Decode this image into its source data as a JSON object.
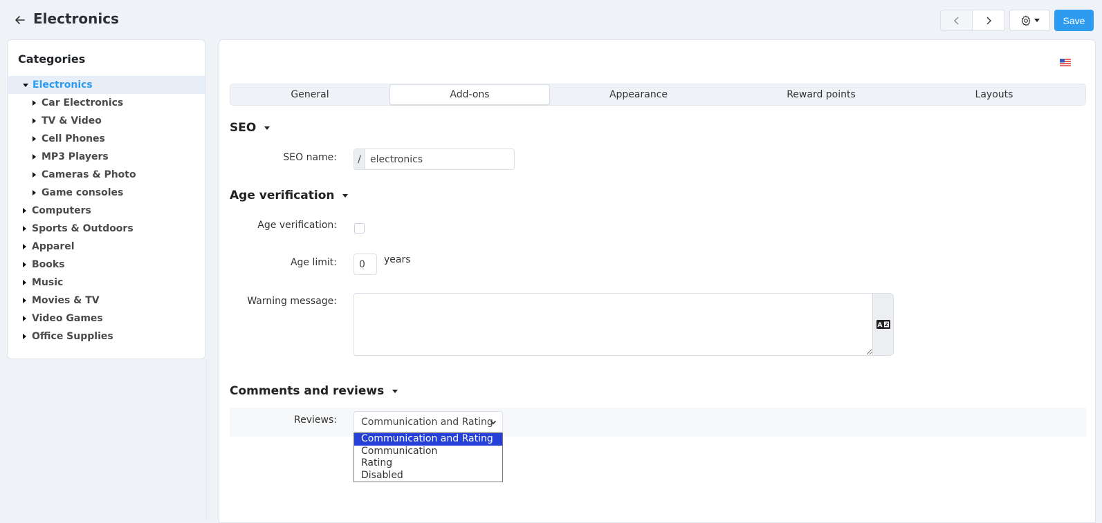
{
  "header": {
    "title": "Electronics",
    "save_label": "Save"
  },
  "sidebar": {
    "title": "Categories",
    "items": [
      {
        "label": "Electronics",
        "level": 0,
        "expanded": true,
        "active": true
      },
      {
        "label": "Car Electronics",
        "level": 1
      },
      {
        "label": "TV & Video",
        "level": 1
      },
      {
        "label": "Cell Phones",
        "level": 1
      },
      {
        "label": "MP3 Players",
        "level": 1
      },
      {
        "label": "Cameras & Photo",
        "level": 1
      },
      {
        "label": "Game consoles",
        "level": 1
      },
      {
        "label": "Computers",
        "level": 0
      },
      {
        "label": "Sports & Outdoors",
        "level": 0
      },
      {
        "label": "Apparel",
        "level": 0
      },
      {
        "label": "Books",
        "level": 0
      },
      {
        "label": "Music",
        "level": 0
      },
      {
        "label": "Movies & TV",
        "level": 0
      },
      {
        "label": "Video Games",
        "level": 0
      },
      {
        "label": "Office Supplies",
        "level": 0
      }
    ]
  },
  "tabs": [
    {
      "label": "General"
    },
    {
      "label": "Add-ons",
      "active": true
    },
    {
      "label": "Appearance"
    },
    {
      "label": "Reward points"
    },
    {
      "label": "Layouts"
    }
  ],
  "seo": {
    "title": "SEO",
    "name_label": "SEO name:",
    "prefix": "/",
    "name_value": "electronics"
  },
  "age": {
    "title": "Age verification",
    "verification_label": "Age verification:",
    "verification_checked": false,
    "limit_label": "Age limit:",
    "limit_value": "0",
    "limit_unit": "years",
    "warning_label": "Warning message:",
    "warning_value": ""
  },
  "comments": {
    "title": "Comments and reviews",
    "reviews_label": "Reviews:",
    "selected": "Communication and Rating",
    "options": [
      "Communication and Rating",
      "Communication",
      "Rating",
      "Disabled"
    ]
  },
  "colors": {
    "accent": "#2d9cf0",
    "dropdown_highlight": "#2541d8",
    "page_bg": "#eff2f7"
  }
}
